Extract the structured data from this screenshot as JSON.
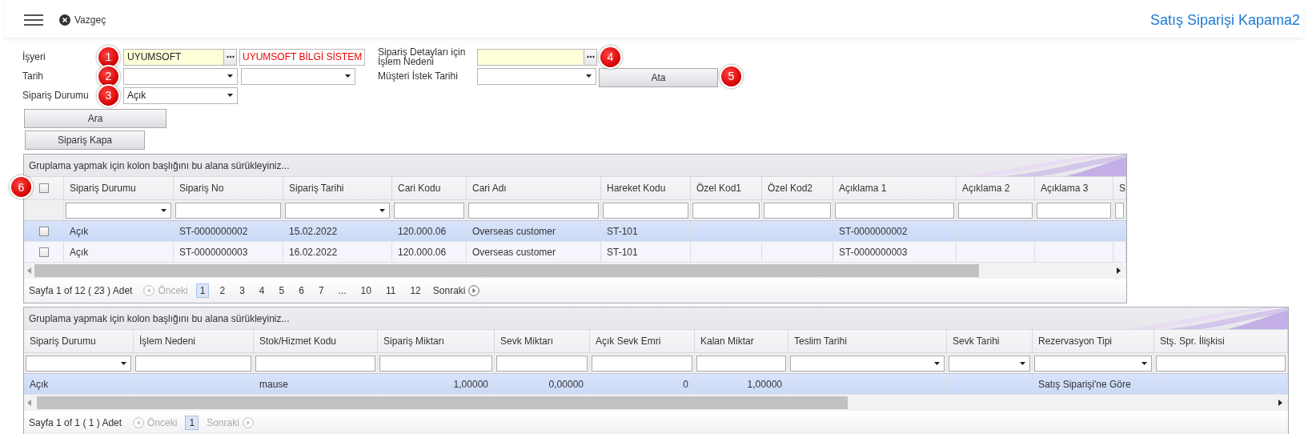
{
  "header": {
    "cancel_button": "Vazgeç",
    "title": "Satış Siparişi Kapama2"
  },
  "form": {
    "left": [
      {
        "label": "İşyeri",
        "marker": "1",
        "controls": [
          {
            "kind": "lookup",
            "value": "UYUMSOFT",
            "required": true
          },
          {
            "kind": "readonly",
            "value": "UYUMSOFT BİLGİ SİSTEM"
          }
        ]
      },
      {
        "label": "Tarih",
        "marker": "2",
        "controls": [
          {
            "kind": "dropdown"
          },
          {
            "kind": "dropdown"
          }
        ]
      },
      {
        "label": "Sipariş Durumu",
        "marker": "3",
        "controls": [
          {
            "kind": "dropdown",
            "value": "Açık"
          }
        ]
      }
    ],
    "right": [
      {
        "label": "Sipariş Detayları için İşlem Nedeni",
        "marker": "4",
        "controls": [
          {
            "kind": "lookup",
            "required": true
          }
        ]
      },
      {
        "label": "Müşteri İstek Tarihi",
        "marker": "5",
        "controls": [
          {
            "kind": "dropdown"
          },
          {
            "kind": "button",
            "label": "Ata"
          }
        ]
      }
    ],
    "buttons": [
      "Ara",
      "Sipariş Kapa"
    ]
  },
  "grids": [
    {
      "group_panel": "Gruplama yapmak için kolon başlığını bu alana sürükleyiniz...",
      "marker": "6",
      "header_checkbox": {
        "checked": false
      },
      "columns": [
        {
          "title": "Sipariş Durumu",
          "kind": "dropdown"
        },
        {
          "title": "Sipariş No",
          "kind": "text"
        },
        {
          "title": "Sipariş Tarihi",
          "kind": "dropdown"
        },
        {
          "title": "Cari Kodu",
          "kind": "text"
        },
        {
          "title": "Cari Adı",
          "kind": "text"
        },
        {
          "title": "Hareket Kodu",
          "kind": "text"
        },
        {
          "title": "Özel Kod1",
          "kind": "text"
        },
        {
          "title": "Özel Kod2",
          "kind": "text"
        },
        {
          "title": "Açıklama 1",
          "kind": "text"
        },
        {
          "title": "Açıklama 2",
          "kind": "text"
        },
        {
          "title": "Açıklama 3",
          "kind": "text"
        },
        {
          "title": "S",
          "kind": "text"
        }
      ],
      "rows": [
        {
          "selected": true,
          "checked": false,
          "cells": [
            "Açık",
            "ST-0000000002",
            "15.02.2022",
            "120.000.06",
            "Overseas customer",
            "ST-101",
            null,
            null,
            "ST-0000000002",
            null,
            null,
            null
          ]
        },
        {
          "selected": false,
          "checked": false,
          "cells": [
            "Açık",
            "ST-0000000003",
            "16.02.2022",
            "120.000.06",
            "Overseas customer",
            "ST-101",
            null,
            null,
            "ST-0000000003",
            null,
            null,
            null
          ]
        }
      ],
      "pager": {
        "summary": "Sayfa 1 of 12 ( 23 ) Adet",
        "previous": {
          "label": "Önceki",
          "disabled": true
        },
        "pages": [
          {
            "label": "1",
            "selected": true
          },
          {
            "label": "2",
            "selected": false
          },
          {
            "label": "3",
            "selected": false
          },
          {
            "label": "4",
            "selected": false
          },
          {
            "label": "5",
            "selected": false
          },
          {
            "label": "6",
            "selected": false
          },
          {
            "label": "7",
            "selected": false
          },
          {
            "label": "...",
            "selected": false
          },
          {
            "label": "10",
            "selected": false
          },
          {
            "label": "11",
            "selected": false
          },
          {
            "label": "12",
            "selected": false
          }
        ],
        "next": {
          "label": "Sonraki",
          "disabled": false
        }
      }
    },
    {
      "group_panel": "Gruplama yapmak için kolon başlığını bu alana sürükleyiniz...",
      "columns": [
        {
          "title": "Sipariş Durumu",
          "kind": "dropdown"
        },
        {
          "title": "İşlem Nedeni",
          "kind": "text"
        },
        {
          "title": "Stok/Hizmet Kodu",
          "kind": "text"
        },
        {
          "title": "Sipariş Miktarı",
          "kind": "text"
        },
        {
          "title": "Sevk Miktarı",
          "kind": "text"
        },
        {
          "title": "Açık Sevk Emri",
          "kind": "text"
        },
        {
          "title": "Kalan Miktar",
          "kind": "text"
        },
        {
          "title": "Teslim Tarihi",
          "kind": "dropdown"
        },
        {
          "title": "Sevk Tarihi",
          "kind": "dropdown"
        },
        {
          "title": "Rezervasyon Tipi",
          "kind": "dropdown"
        },
        {
          "title": "Stş. Spr. İlişkisi",
          "kind": "text"
        }
      ],
      "rows": [
        {
          "selected": true,
          "cells": [
            "Açık",
            null,
            "mause",
            "1,00000",
            "0,00000",
            "0",
            "1,00000",
            null,
            null,
            "Satış Siparişi'ne Göre",
            null
          ]
        }
      ],
      "pager": {
        "summary": "Sayfa 1 of 1 ( 1 ) Adet",
        "previous": {
          "label": "Önceki",
          "disabled": true
        },
        "pages": [
          {
            "label": "1",
            "selected": true
          }
        ],
        "next": {
          "label": "Sonraki",
          "disabled": true
        }
      }
    }
  ]
}
